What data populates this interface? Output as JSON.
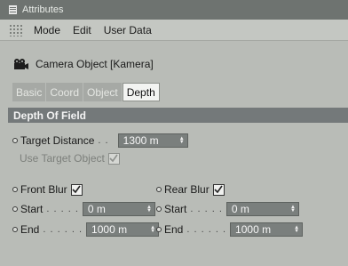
{
  "window": {
    "title": "Attributes"
  },
  "menu": {
    "items": [
      "Mode",
      "Edit",
      "User Data"
    ]
  },
  "object": {
    "title": "Camera Object [Kamera]"
  },
  "tabs": [
    {
      "label": "Basic",
      "active": false
    },
    {
      "label": "Coord",
      "active": false
    },
    {
      "label": "Object",
      "active": false
    },
    {
      "label": "Depth",
      "active": true
    }
  ],
  "section": {
    "title": "Depth Of Field"
  },
  "fields": {
    "target_distance": {
      "label": "Target Distance",
      "value": "1300 m"
    },
    "use_target": {
      "label": "Use Target Object",
      "checked": true,
      "enabled": false
    },
    "front_blur": {
      "label": "Front Blur",
      "checked": true
    },
    "rear_blur": {
      "label": "Rear Blur",
      "checked": true
    },
    "front_start": {
      "label": "Start",
      "value": "0 m"
    },
    "front_end": {
      "label": "End",
      "value": "1000 m"
    },
    "rear_start": {
      "label": "Start",
      "value": "0 m"
    },
    "rear_end": {
      "label": "End",
      "value": "1000 m"
    }
  },
  "colors": {
    "section_bg": "#74797a",
    "field_bg": "#7a7f7d",
    "panel_bg": "#b9bcb7"
  }
}
